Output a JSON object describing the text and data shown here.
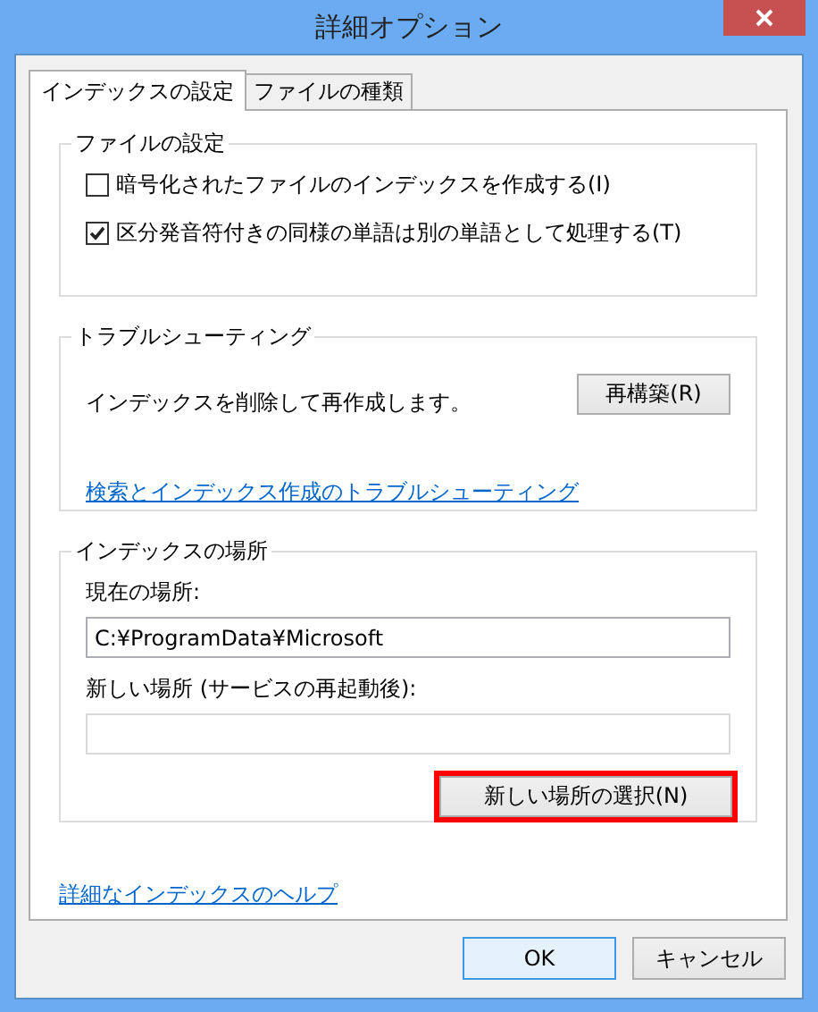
{
  "window": {
    "title": "詳細オプション"
  },
  "tabs": [
    {
      "label": "インデックスの設定",
      "selected": true
    },
    {
      "label": "ファイルの種類",
      "selected": false
    }
  ],
  "file_settings": {
    "title": "ファイルの設定",
    "options": [
      {
        "label": "暗号化されたファイルのインデックスを作成する(I)",
        "checked": false
      },
      {
        "label": "区分発音符付きの同様の単語は別の単語として処理する(T)",
        "checked": true
      }
    ]
  },
  "troubleshooting": {
    "title": "トラブルシューティング",
    "description": "インデックスを削除して再作成します。",
    "rebuild_button": "再構築(R)",
    "link": "検索とインデックス作成のトラブルシューティング"
  },
  "index_location": {
    "title": "インデックスの場所",
    "current_label": "現在の場所:",
    "current_value": "C:¥ProgramData¥Microsoft",
    "new_label": "新しい場所 (サービスの再起動後):",
    "select_button": {
      "label": "新しい場所の選択(N)",
      "highlighted": true
    }
  },
  "help_link": "詳細なインデックスのヘルプ",
  "buttons": [
    {
      "label": "OK",
      "default": true
    },
    {
      "label": "キャンセル",
      "default": false
    }
  ]
}
